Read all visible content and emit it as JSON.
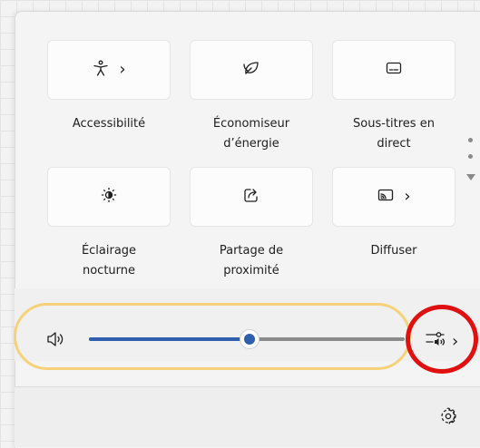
{
  "quick_settings": {
    "tiles": [
      {
        "label": "Accessibilité",
        "icon": "accessibility-icon",
        "has_chevron": true
      },
      {
        "label": "Économiseur\nd’énergie",
        "icon": "energy-saver-icon",
        "has_chevron": false
      },
      {
        "label": "Sous-titres en\ndirect",
        "icon": "live-captions-icon",
        "has_chevron": false
      },
      {
        "label": "Éclairage\nnocturne",
        "icon": "night-light-icon",
        "has_chevron": false
      },
      {
        "label": "Partage de\nproximité",
        "icon": "nearby-share-icon",
        "has_chevron": false
      },
      {
        "label": "Diffuser",
        "icon": "cast-icon",
        "has_chevron": true
      }
    ],
    "chevron": "›"
  },
  "volume": {
    "level_fraction": 0.51,
    "icon": "speaker-icon",
    "mixer_icon": "volume-mixer-icon",
    "chevron": "›"
  },
  "footer": {
    "settings_icon": "gear-icon"
  },
  "colors": {
    "accent": "#2f5fae",
    "highlight_yellow": "#f5d27a",
    "annotation_red": "#e01010"
  }
}
